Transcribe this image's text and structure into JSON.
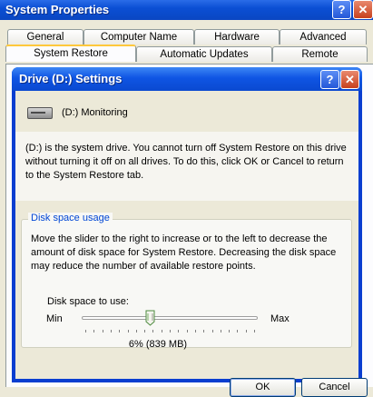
{
  "outer_window": {
    "title": "System Properties",
    "help_glyph": "?",
    "close_glyph": "✕"
  },
  "tabs_row1": [
    "General",
    "Computer Name",
    "Hardware",
    "Advanced"
  ],
  "tabs_row2": [
    "System Restore",
    "Automatic Updates",
    "Remote"
  ],
  "active_tab": "System Restore",
  "dialog": {
    "title": "Drive (D:) Settings",
    "help_glyph": "?",
    "close_glyph": "✕",
    "drive_label": "(D:)  Monitoring",
    "info_text": "(D:) is the system drive. You cannot turn off System Restore on this drive without turning it off on all drives. To do this, click OK or Cancel to return to the System Restore tab.",
    "group_title": "Disk space usage",
    "group_text": "Move the slider to the right to increase or to the left to decrease the amount of disk space for System Restore. Decreasing the disk space may reduce the number of available restore points.",
    "disk_space_label": "Disk space to use:",
    "min_label": "Min",
    "max_label": "Max",
    "slider_value_fraction": 0.06,
    "percent_label": "6% (839 MB)",
    "ok_label": "OK",
    "cancel_label": "Cancel"
  },
  "colors": {
    "title_blue": "#0A49D0",
    "group_title": "#0046D5",
    "active_tab_accent": "#FFC83C"
  }
}
